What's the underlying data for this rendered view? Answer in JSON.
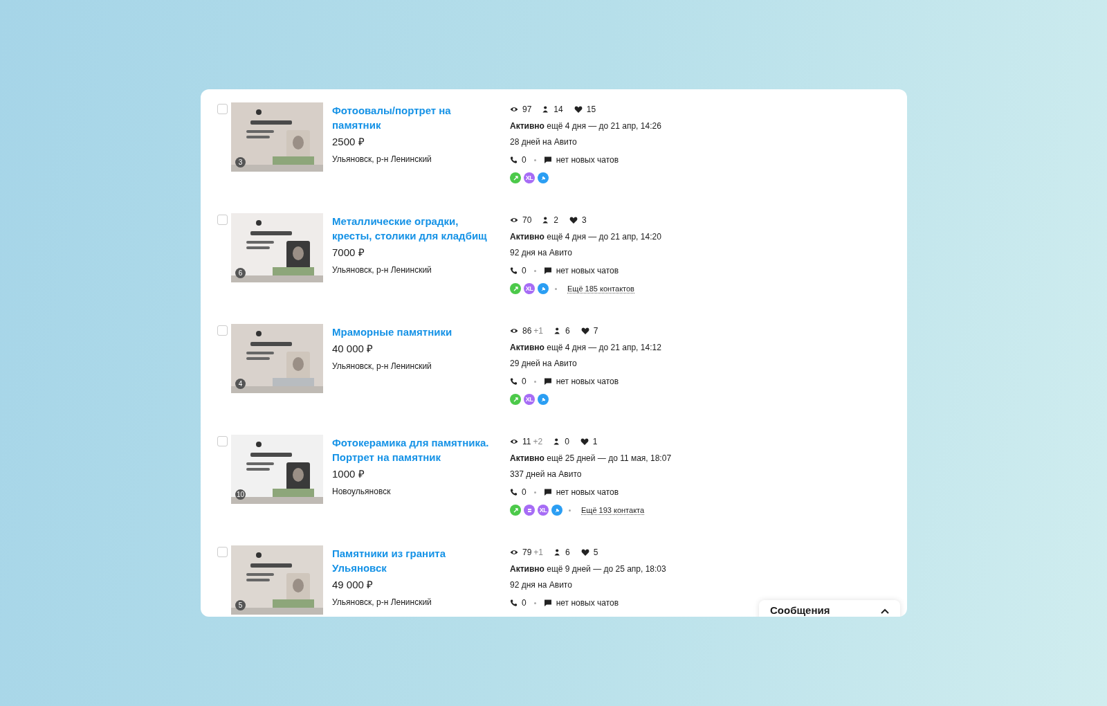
{
  "listings": [
    {
      "checked": false,
      "photo_count": "3",
      "title": "Фотоовалы/портрет на памятник",
      "price": "2500 ₽",
      "location": "Ульяновск, р-н Ленинский",
      "views": "97",
      "contacts": "14",
      "favorites": "15",
      "status": "Активно",
      "remaining": "ещё 4 дня — до 21 апр, 14:26",
      "age": "28 дней на Авито",
      "calls": "0",
      "chats": "нет новых чатов",
      "services": [
        {
          "kind": "raise",
          "color": "#4cc94a"
        },
        {
          "kind": "xl",
          "label": "XL",
          "color": "#a66cf5"
        },
        {
          "kind": "pin",
          "color": "#2b9ef3"
        }
      ]
    },
    {
      "checked": false,
      "photo_count": "6",
      "title": "Металлические оградки, кресты, столики для кладбищ",
      "price": "7000 ₽",
      "location": "Ульяновск, р-н Ленинский",
      "views": "70",
      "contacts": "2",
      "favorites": "3",
      "status": "Активно",
      "remaining": "ещё 4 дня — до 21 апр, 14:20",
      "age": "92 дня на Авито",
      "calls": "0",
      "chats": "нет новых чатов",
      "services": [
        {
          "kind": "raise",
          "color": "#4cc94a"
        },
        {
          "kind": "xl",
          "label": "XL",
          "color": "#a66cf5"
        },
        {
          "kind": "pin",
          "color": "#2b9ef3"
        }
      ],
      "more_contacts": "Ещё 185 контактов"
    },
    {
      "checked": false,
      "photo_count": "4",
      "title": "Мраморные памятники",
      "price": "40 000 ₽",
      "location": "Ульяновск, р-н Ленинский",
      "views": "86",
      "views_delta": "+1",
      "contacts": "6",
      "favorites": "7",
      "status": "Активно",
      "remaining": "ещё 4 дня — до 21 апр, 14:12",
      "age": "29 дней на Авито",
      "calls": "0",
      "chats": "нет новых чатов",
      "services": [
        {
          "kind": "raise",
          "color": "#4cc94a"
        },
        {
          "kind": "xl",
          "label": "XL",
          "color": "#a66cf5"
        },
        {
          "kind": "pin",
          "color": "#2b9ef3"
        }
      ]
    },
    {
      "checked": false,
      "photo_count": "10",
      "title": "Фотокерамика для памятника. Портрет на памятник",
      "price": "1000 ₽",
      "location": "Новоульяновск",
      "views": "11",
      "views_delta": "+2",
      "contacts": "0",
      "favorites": "1",
      "status": "Активно",
      "remaining": "ещё 25 дней — до 11 мая, 18:07",
      "age": "337 дней на Авито",
      "calls": "0",
      "chats": "нет новых чатов",
      "services": [
        {
          "kind": "raise",
          "color": "#4cc94a"
        },
        {
          "kind": "stack",
          "color": "#a66cf5"
        },
        {
          "kind": "xl",
          "label": "XL",
          "color": "#a66cf5"
        },
        {
          "kind": "pin",
          "color": "#2b9ef3"
        }
      ],
      "more_contacts": "Ещё 193 контакта"
    },
    {
      "checked": false,
      "photo_count": "5",
      "title": "Памятники из гранита Ульяновск",
      "price": "49 000 ₽",
      "location": "Ульяновск, р-н Ленинский",
      "views": "79",
      "views_delta": "+1",
      "contacts": "6",
      "favorites": "5",
      "status": "Активно",
      "remaining": "ещё 9 дней — до 25 апр, 18:03",
      "age": "92 дня на Авито",
      "calls": "0",
      "chats": "нет новых чатов"
    }
  ],
  "messages_widget": {
    "title": "Сообщения",
    "expanded": false
  }
}
